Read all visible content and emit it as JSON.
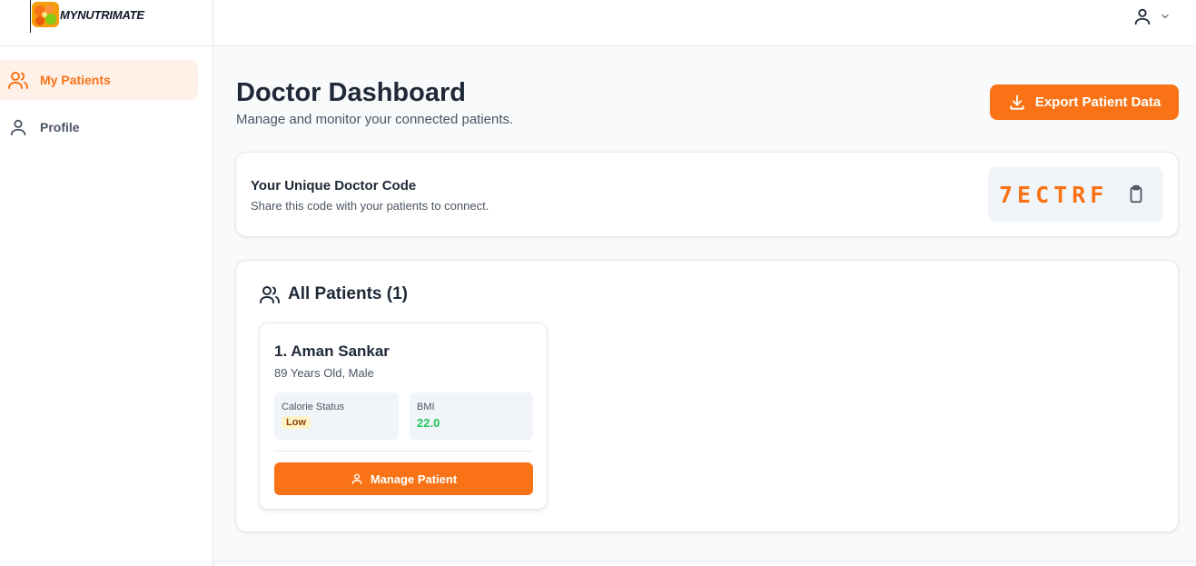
{
  "brand": {
    "name": "MYNUTRIMATE",
    "logo_icon": "nutrition-logo-icon"
  },
  "header": {
    "user_icon": "user-icon",
    "dropdown_icon": "chevron-down-icon"
  },
  "sidebar": {
    "items": [
      {
        "label": "My Patients",
        "icon": "users-icon",
        "active": true
      },
      {
        "label": "Profile",
        "icon": "user-icon",
        "active": false
      }
    ]
  },
  "page": {
    "title": "Doctor Dashboard",
    "subtitle": "Manage and monitor your connected patients.",
    "export_label": "Export Patient Data"
  },
  "doctor_code": {
    "title": "Your Unique Doctor Code",
    "description": "Share this code with your patients to connect.",
    "code": "7ECTRF"
  },
  "patients": {
    "title": "All Patients (1)",
    "list": [
      {
        "name": "1. Aman Sankar",
        "meta": "89 Years Old, Male",
        "calorie_label": "Calorie Status",
        "calorie_status": "Low",
        "bmi_label": "BMI",
        "bmi_value": "22.0",
        "action_label": "Manage Patient"
      }
    ]
  },
  "colors": {
    "accent": "#f97316",
    "active_bg": "#fff1e8",
    "bmi_ok": "#22c55e",
    "badge_low_bg": "#fef3c7"
  }
}
